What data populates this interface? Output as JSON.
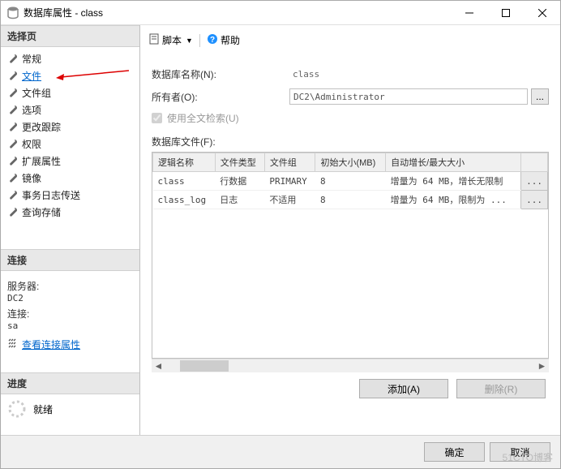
{
  "window": {
    "title": "数据库属性 - class"
  },
  "sidebar": {
    "pages_header": "选择页",
    "items": [
      {
        "label": "常规"
      },
      {
        "label": "文件"
      },
      {
        "label": "文件组"
      },
      {
        "label": "选项"
      },
      {
        "label": "更改跟踪"
      },
      {
        "label": "权限"
      },
      {
        "label": "扩展属性"
      },
      {
        "label": "镜像"
      },
      {
        "label": "事务日志传送"
      },
      {
        "label": "查询存储"
      }
    ],
    "conn_header": "连接",
    "server_label": "服务器:",
    "server_value": "DC2",
    "connection_label": "连接:",
    "connection_value": "sa",
    "view_props_link": "查看连接属性",
    "progress_header": "进度",
    "progress_status": "就绪"
  },
  "toolbar": {
    "script": "脚本",
    "help": "帮助"
  },
  "form": {
    "db_name_label": "数据库名称(N):",
    "db_name_value": "class",
    "owner_label": "所有者(O):",
    "owner_value": "DC2\\Administrator",
    "fulltext_label": "使用全文检索(U)",
    "files_label": "数据库文件(F):"
  },
  "grid": {
    "headers": [
      "逻辑名称",
      "文件类型",
      "文件组",
      "初始大小(MB)",
      "自动增长/最大大小",
      ""
    ],
    "rows": [
      {
        "name": "class",
        "type": "行数据",
        "group": "PRIMARY",
        "size": "8",
        "growth": "增量为 64 MB，增长无限制"
      },
      {
        "name": "class_log",
        "type": "日志",
        "group": "不适用",
        "size": "8",
        "growth": "增量为 64 MB，限制为 ..."
      }
    ]
  },
  "actions": {
    "add": "添加(A)",
    "remove": "删除(R)"
  },
  "footer": {
    "ok": "确定",
    "cancel": "取消"
  },
  "watermark": "51CTO博客"
}
